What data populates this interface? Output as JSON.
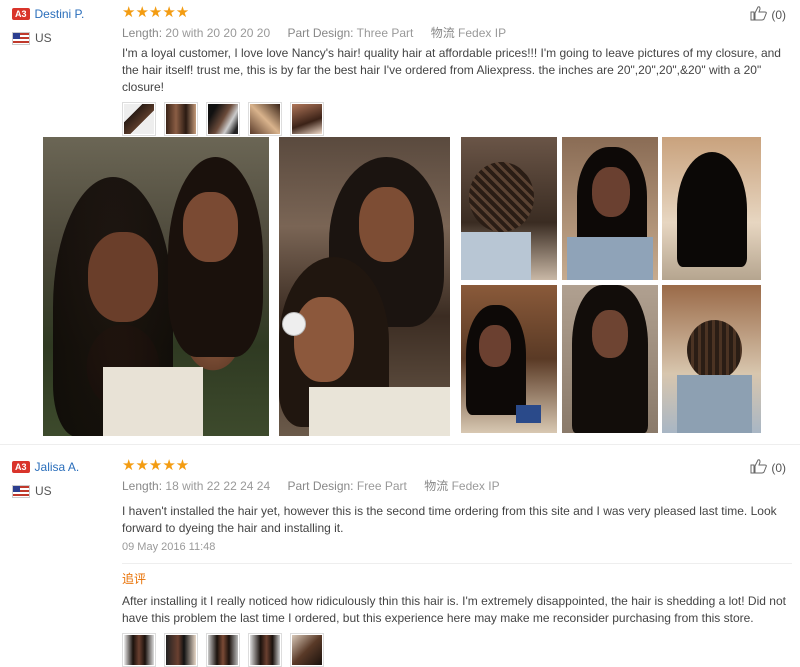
{
  "review1": {
    "badge": "A3",
    "name": "Destini P.",
    "country": "US",
    "stars": "★★★★★",
    "length_label": "Length:",
    "length_value": "20 with 20 20 20 20",
    "part_label": "Part Design:",
    "part_value": "Three Part",
    "ship_label": "物流",
    "ship_value": "Fedex IP",
    "text": "I'm a loyal customer, I love love Nancy's hair! quality hair at affordable prices!!! I'm going to leave pictures of my closure, and the hair itself! trust me, this is by far the best hair I've ordered from Aliexpress. the inches are 20\",20\",20\",&20\" with a 20\" closure!",
    "helpful": "(0)"
  },
  "review2": {
    "badge": "A3",
    "name": "Jalisa A.",
    "country": "US",
    "stars": "★★★★★",
    "length_label": "Length:",
    "length_value": "18 with 22 22 24 24",
    "part_label": "Part Design:",
    "part_value": "Free Part",
    "ship_label": "物流",
    "ship_value": "Fedex IP",
    "text": "I haven't installed the hair yet, however this is the second time ordering from this site and I was very pleased last time. Look forward to dyeing the hair and installing it.",
    "date": "09 May 2016 11:48",
    "additional_label": "追评",
    "additional_text": "After installing it I really noticed how ridiculously thin this hair is. I'm extremely disappointed, the hair is shedding a lot! Did not have this problem the last time I ordered, but this experience here may make me reconsider purchasing from this store.",
    "helpful": "(0)"
  }
}
